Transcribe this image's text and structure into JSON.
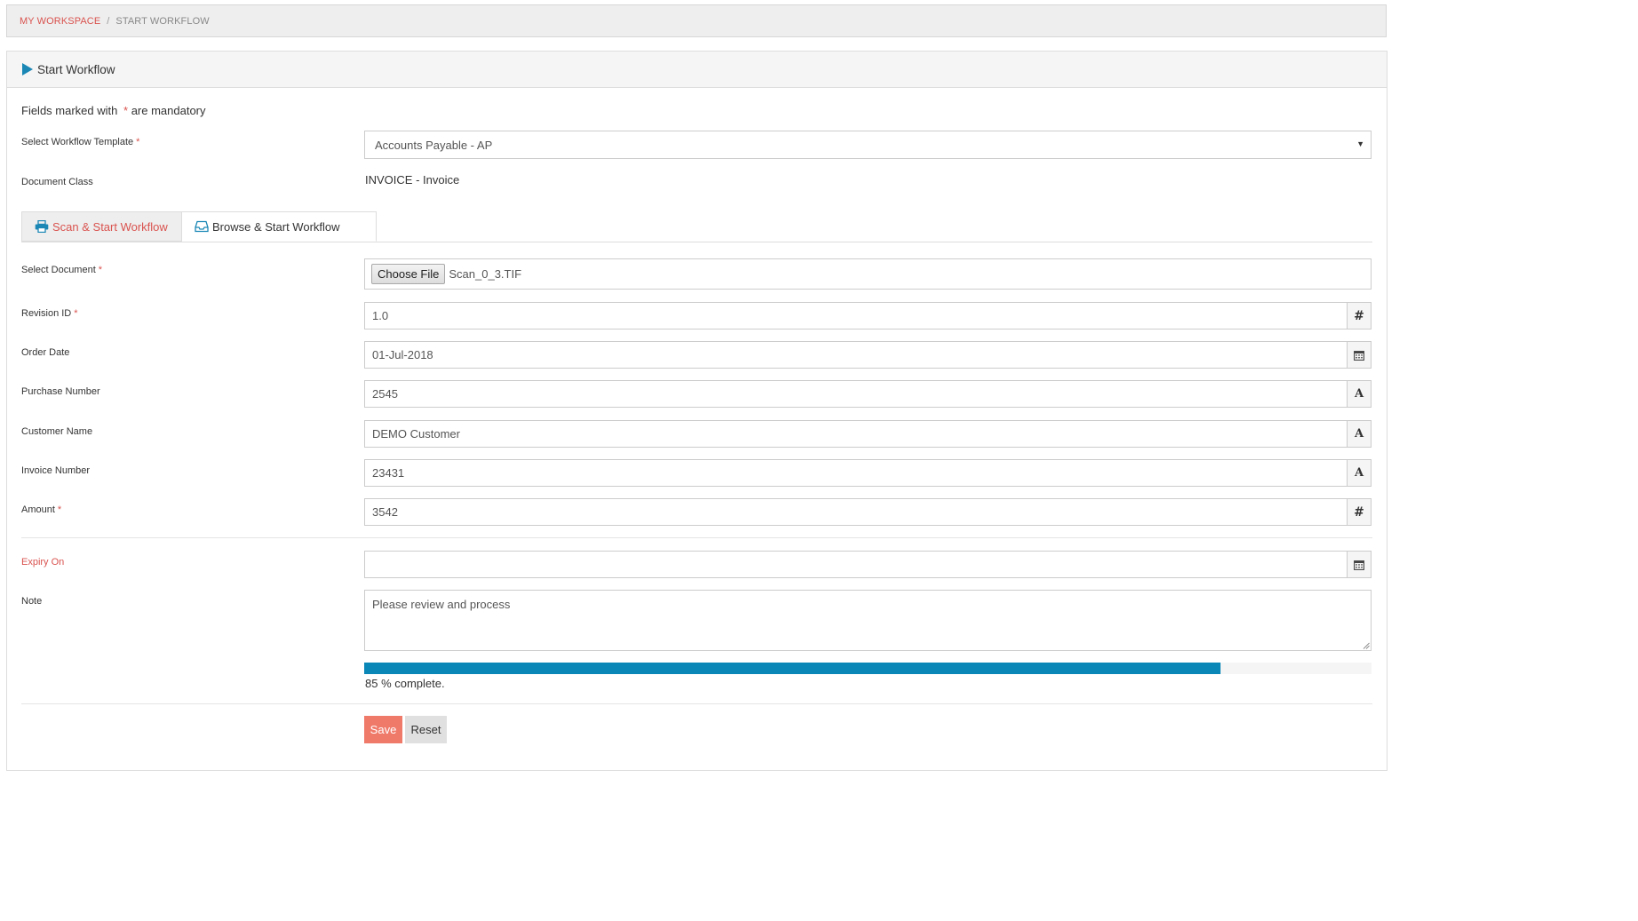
{
  "breadcrumb": {
    "home": "MY WORKSPACE",
    "separator": "/",
    "current": "START WORKFLOW"
  },
  "panel": {
    "title": "Start Workflow"
  },
  "mandatory_note": {
    "prefix": "Fields marked with",
    "star": "*",
    "suffix": "are mandatory"
  },
  "form": {
    "template_label": "Select Workflow Template",
    "template_value": "Accounts Payable - AP",
    "doc_class_label": "Document Class",
    "doc_class_value": "INVOICE - Invoice",
    "tabs": {
      "scan": "Scan & Start Workflow",
      "browse": "Browse & Start Workflow"
    },
    "select_doc_label": "Select Document",
    "choose_file": "Choose File",
    "file_name": "Scan_0_3.TIF",
    "fields": {
      "revision": {
        "label": "Revision ID",
        "value": "1.0",
        "addon": "#"
      },
      "order_date": {
        "label": "Order Date",
        "value": "01-Jul-2018",
        "addon": "calendar-icon"
      },
      "purchase": {
        "label": "Purchase Number",
        "value": "2545",
        "addon": "A"
      },
      "customer": {
        "label": "Customer Name",
        "value": "DEMO Customer",
        "addon": "A"
      },
      "invoice": {
        "label": "Invoice Number",
        "value": "23431",
        "addon": "A"
      },
      "amount": {
        "label": "Amount",
        "value": "3542",
        "addon": "#"
      }
    },
    "expiry_label": "Expiry On",
    "expiry_value": "",
    "note_label": "Note",
    "note_value": "Please review and process",
    "progress": {
      "percent": 85,
      "text": "85 % complete."
    },
    "buttons": {
      "save": "Save",
      "reset": "Reset"
    },
    "required_mark": "*"
  },
  "colors": {
    "accent_red": "#d9534f",
    "progress_blue": "#0a86b7",
    "save_button": "#f07a6a"
  }
}
